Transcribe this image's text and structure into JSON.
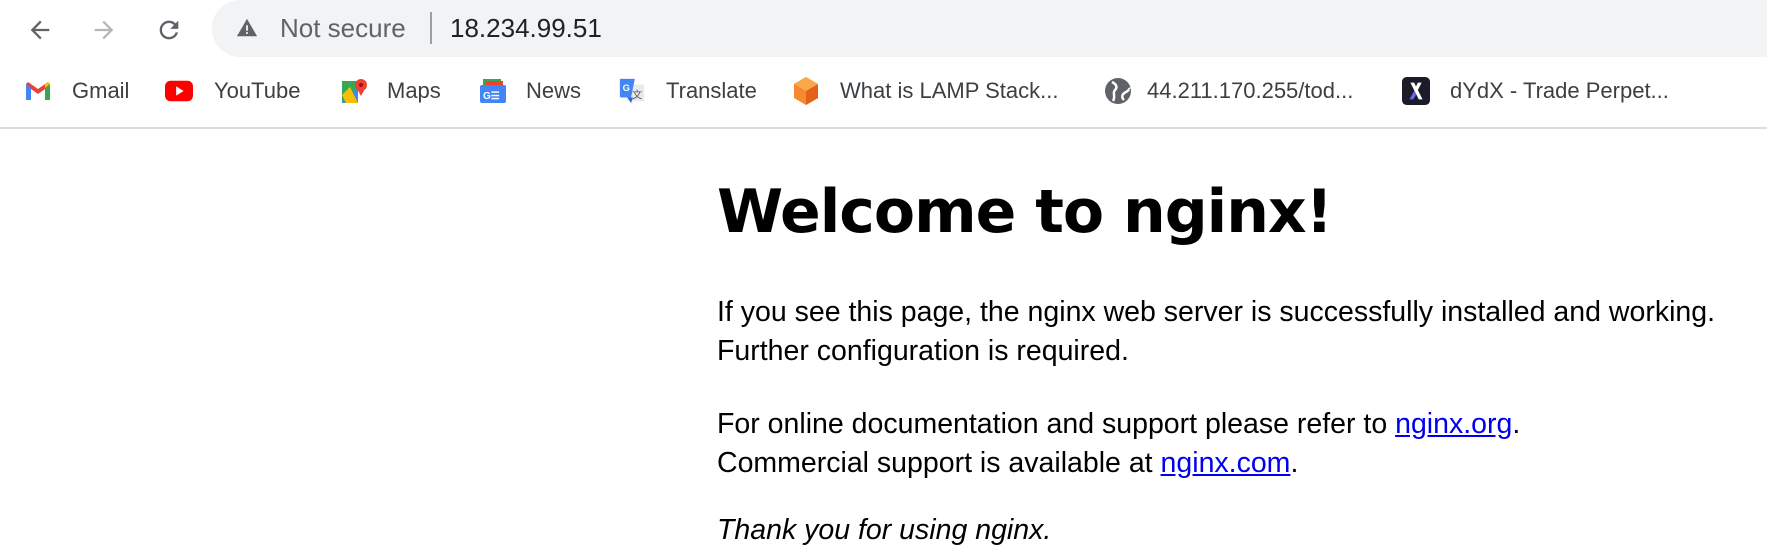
{
  "browser": {
    "security_label": "Not secure",
    "url": "18.234.99.51",
    "icons": [
      "back-arrow-icon",
      "forward-arrow-icon",
      "reload-icon",
      "warning-icon"
    ]
  },
  "bookmarks": [
    {
      "label": "Gmail",
      "icon": "gmail-icon"
    },
    {
      "label": "YouTube",
      "icon": "youtube-icon"
    },
    {
      "label": "Maps",
      "icon": "maps-icon"
    },
    {
      "label": "News",
      "icon": "news-icon"
    },
    {
      "label": "Translate",
      "icon": "translate-icon"
    },
    {
      "label": "What is LAMP Stack...",
      "icon": "cube-icon"
    },
    {
      "label": "44.211.170.255/tod...",
      "icon": "globe-icon"
    },
    {
      "label": "dYdX - Trade Perpet...",
      "icon": "dydx-icon"
    }
  ],
  "page": {
    "title": "Welcome to nginx!",
    "para1": "If you see this page, the nginx web server is successfully installed and working. Further configuration is required.",
    "para2_pre": "For online documentation and support please refer to ",
    "link_org": "nginx.org",
    "para2_mid": ".",
    "para2_line2": "Commercial support is available at ",
    "link_com": "nginx.com",
    "para2_end": ".",
    "thanks": "Thank you for using nginx."
  },
  "colors": {
    "link": "#0000ee",
    "omnibox": "#f1f3f4"
  }
}
